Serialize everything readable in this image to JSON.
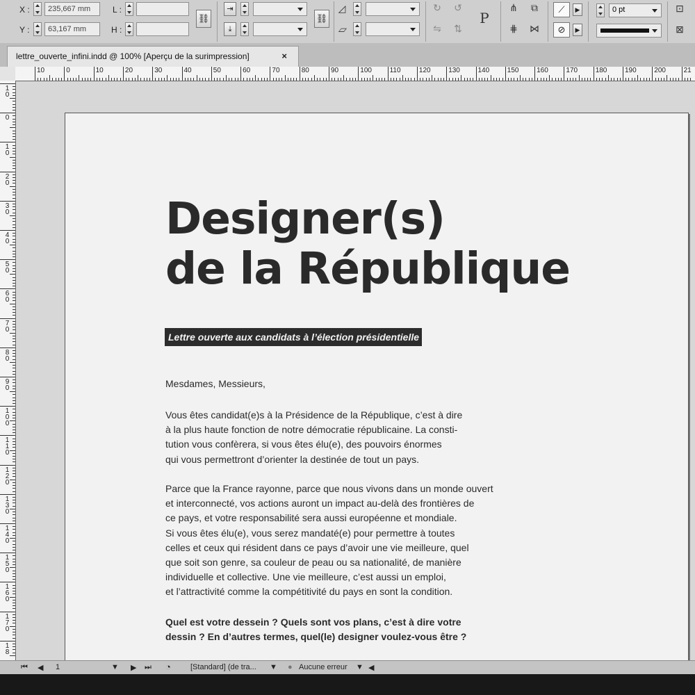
{
  "control_panel": {
    "x_label": "X :",
    "x_value": "235,667 mm",
    "y_label": "Y :",
    "y_value": "63,167 mm",
    "l_label": "L :",
    "h_label": "H :",
    "stroke_weight": "0 pt",
    "text_frame_icon": "P"
  },
  "tab": {
    "title": "lettre_ouverte_infini.indd @ 100% [Aperçu de la surimpression]",
    "close_glyph": "×"
  },
  "ruler": {
    "horizontal": [
      "10",
      "0",
      "10",
      "20",
      "30",
      "40",
      "50",
      "60",
      "70",
      "80",
      "90",
      "100",
      "110",
      "120",
      "130",
      "140",
      "150",
      "160",
      "170",
      "180",
      "190",
      "200",
      "21"
    ],
    "vertical": [
      "10",
      "0",
      "10",
      "20",
      "30",
      "40",
      "50",
      "60",
      "70",
      "80",
      "90",
      "100",
      "110",
      "120",
      "130",
      "140",
      "150",
      "160",
      "170",
      "18"
    ]
  },
  "document": {
    "title_line1": "Designer(s)",
    "title_line2": "de la République",
    "subtitle": "Lettre ouverte aux candidats à l’élection présidentielle",
    "salutation": "Mesdames, Messieurs,",
    "paragraph1": [
      "Vous êtes candidat(e)s à la Présidence de la République, c’est à dire",
      "à la plus haute fonction de notre démocratie républicaine. La consti-",
      "tution vous confèrera, si vous êtes élu(e), des pouvoirs énormes",
      "qui vous permettront d’orienter la destinée de tout un pays."
    ],
    "paragraph2": [
      "Parce que la France rayonne, parce que nous vivons dans un monde ouvert",
      "et interconnecté, vos actions auront un impact au-delà des frontières de",
      "ce pays, et votre responsabilité sera aussi européenne et mondiale.",
      "Si vous êtes élu(e), vous serez mandaté(e) pour permettre à toutes",
      "celles et ceux qui résident dans ce pays d’avoir une vie meilleure, quel",
      "que soit son genre, sa couleur de peau ou sa nationalité, de manière",
      "individuelle et collective. Une vie meilleure, c’est aussi un emploi,",
      "et l’attractivité comme la compétitivité du pays en sont la condition."
    ],
    "paragraph3": [
      "Quel est votre dessein ? Quels sont vos plans, c’est à dire votre",
      "dessin ? En d’autres termes, quel(le) designer voulez-vous être ?"
    ]
  },
  "statusbar": {
    "page_number": "1",
    "style": "[Standard] (de tra...",
    "preflight": "Aucune erreur"
  }
}
